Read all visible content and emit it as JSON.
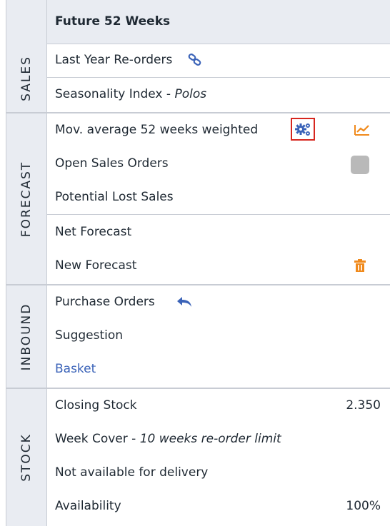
{
  "header": {
    "title": "Future 52 Weeks"
  },
  "sections": {
    "sales": {
      "label": "SALES",
      "rows": {
        "last_year": {
          "label": "Last Year Re-orders",
          "icon": "link-icon"
        },
        "seasonality": {
          "label": "Seasonality Index - ",
          "italic": "Polos"
        }
      }
    },
    "forecast": {
      "label": "FORECAST",
      "rows": {
        "mov_avg": {
          "label": "Mov. average 52 weeks weighted",
          "icon": "settings-gears-icon",
          "chart_icon": "line-chart-icon"
        },
        "open_sales": {
          "label": "Open Sales Orders"
        },
        "lost_sales": {
          "label": "Potential Lost Sales"
        },
        "net_forecast": {
          "label": "Net Forecast"
        },
        "new_forecast": {
          "label": "New Forecast",
          "icon": "trash-icon"
        }
      }
    },
    "inbound": {
      "label": "INBOUND",
      "rows": {
        "purchase_orders": {
          "label": "Purchase Orders",
          "icon": "reply-arrow-icon"
        },
        "suggestion": {
          "label": "Suggestion"
        },
        "basket": {
          "label": "Basket"
        }
      }
    },
    "stock": {
      "label": "STOCK",
      "rows": {
        "closing_stock": {
          "label": "Closing Stock",
          "value": "2.350"
        },
        "week_cover": {
          "label": "Week Cover - ",
          "italic": "10 weeks re-order limit"
        },
        "not_available": {
          "label": "Not available for delivery"
        },
        "availability": {
          "label": "Availability",
          "value": "100%"
        }
      }
    }
  },
  "colors": {
    "accent_blue": "#3b63b8",
    "accent_orange": "#f08a1c",
    "highlight_red": "#d7261e",
    "header_bg": "#e9ecf2",
    "border": "#c8ccd4"
  }
}
